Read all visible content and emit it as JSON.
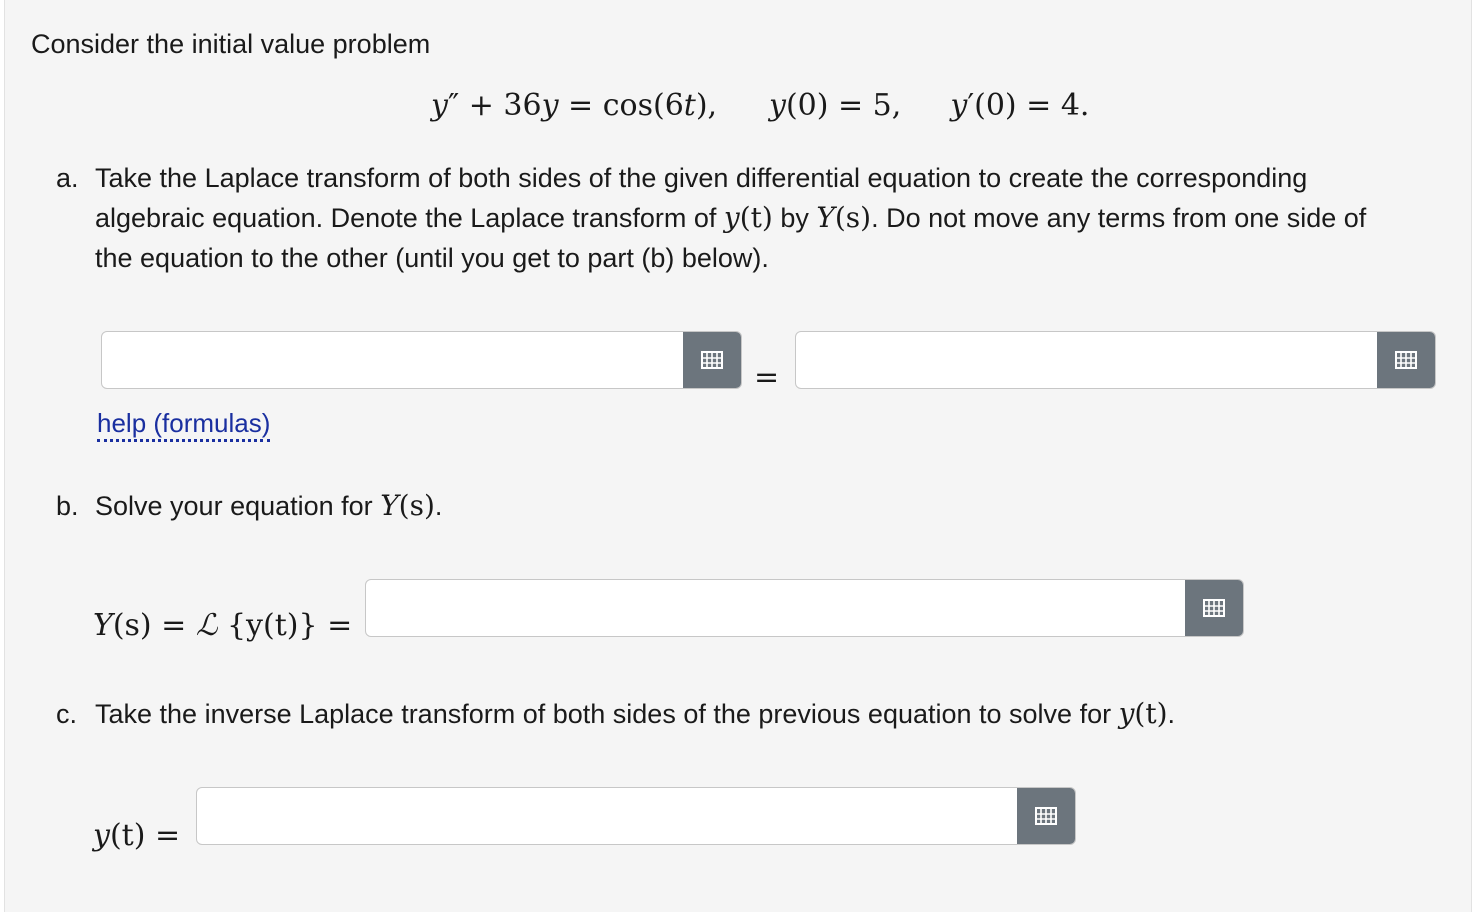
{
  "intro": "Consider the initial value problem",
  "ivp": {
    "lhs_y": "y",
    "dprime": "″",
    "plus_36y": " + 36",
    "y2": "y",
    "eq_cos": " = cos(6",
    "t": "t",
    "close": "),",
    "ic1_y": "y",
    "ic1_rest": "(0) = 5,",
    "ic2_y": "y",
    "ic2_prime": "′",
    "ic2_rest": "(0) = 4."
  },
  "part_a": {
    "marker": "a.",
    "line1": "Take the Laplace transform of both sides of the given differential equation to create the corresponding",
    "line2_pre": "algebraic equation. Denote the Laplace transform of ",
    "line2_y": "y",
    "line2_t": "(t)",
    "line2_by": " by ",
    "line2_Y": "Y",
    "line2_s": "(s)",
    "line2_post": ". Do not move any terms from one side of",
    "line3": "the equation to the other (until you get to part (b) below).",
    "equals": "=",
    "lhs_value": "",
    "rhs_value": "",
    "help_link": "help (formulas)"
  },
  "part_b": {
    "marker": "b.",
    "text_pre": "Solve your equation for ",
    "text_Y": "Y",
    "text_s": "(s)",
    "text_post": ".",
    "label_Y": "Y",
    "label_s": "(s) = ",
    "label_L": "ℒ",
    "label_brace": " {y(t)} =",
    "value": ""
  },
  "part_c": {
    "marker": "c.",
    "text_pre": "Take the inverse Laplace transform of both sides of the previous equation to solve for ",
    "text_y": "y",
    "text_t": "(t)",
    "text_post": ".",
    "label_y": "y",
    "label_rest": "(t) =",
    "value": ""
  },
  "icons": {
    "matrix_button": "grid-icon"
  },
  "colors": {
    "button_bg": "#6c757d",
    "link": "#1a2fa0",
    "panel_bg": "#f5f5f5"
  }
}
